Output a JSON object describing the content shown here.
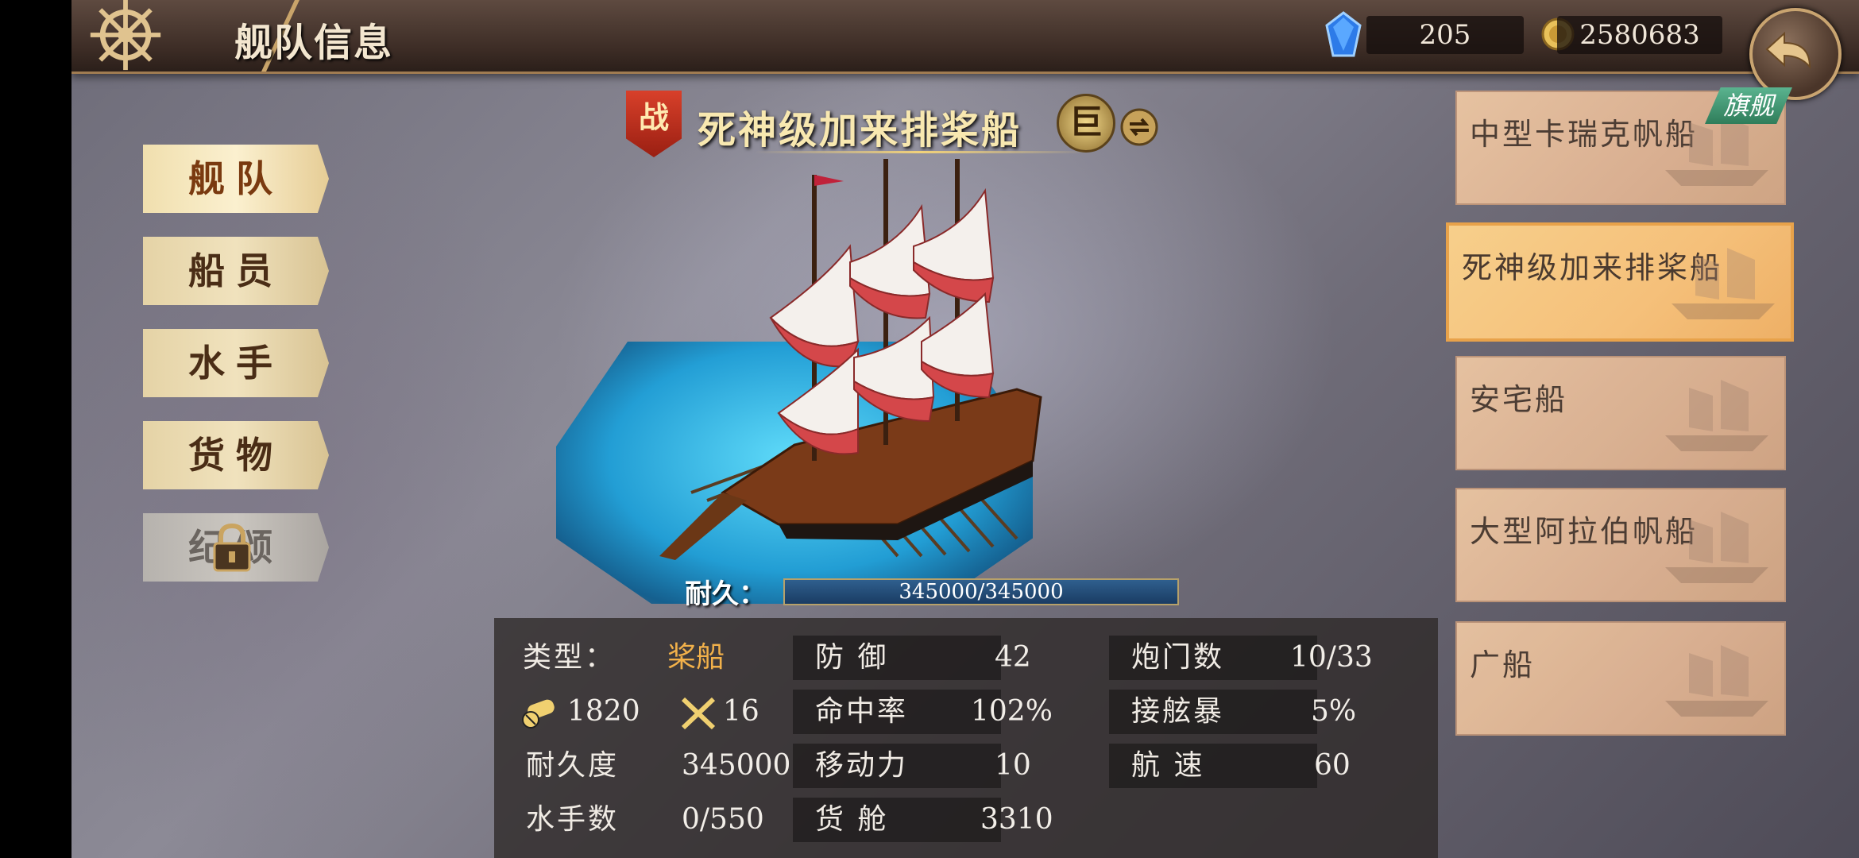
{
  "header": {
    "title": "舰队信息",
    "gems": "205",
    "gold": "2580683"
  },
  "tabs": [
    {
      "label": "舰队",
      "active": true,
      "locked": false
    },
    {
      "label": "船员",
      "active": false,
      "locked": false
    },
    {
      "label": "水手",
      "active": false,
      "locked": false
    },
    {
      "label": "货物",
      "active": false,
      "locked": false
    },
    {
      "label": "纪颂",
      "active": false,
      "locked": true
    }
  ],
  "ship": {
    "badge": "战",
    "name": "死神级加来排桨船",
    "size": "巨",
    "durability_label": "耐久：",
    "durability": "345000/345000"
  },
  "stats": {
    "type_label": "类型：",
    "type_value": "桨船",
    "cannon_power": "1820",
    "melee_power": "16",
    "hp_label": "耐久度",
    "hp_value": "345000",
    "crew_label": "水手数",
    "crew_value": "0/550",
    "defense_label": "防  御",
    "defense_value": "42",
    "accuracy_label": "命中率",
    "accuracy_value": "102%",
    "mobility_label": "移动力",
    "mobility_value": "10",
    "cargo_label": "货  舱",
    "cargo_value": "3310",
    "gunports_label": "炮门数",
    "gunports_value": "10/33",
    "boarding_label": "接舷暴",
    "boarding_value": "5%",
    "speed_label": "航  速",
    "speed_value": "60"
  },
  "fleet_list": [
    {
      "name": "中型卡瑞克帆船",
      "flagship_tag": "旗舰"
    },
    {
      "name": "死神级加来排桨船",
      "selected": true
    },
    {
      "name": "安宅船"
    },
    {
      "name": "大型阿拉伯帆船"
    },
    {
      "name": "广船"
    }
  ],
  "colors": {
    "accent_gold": "#f2b14a",
    "selected_item": "#f5c07a",
    "durability_bar": "#2f5f8e"
  }
}
